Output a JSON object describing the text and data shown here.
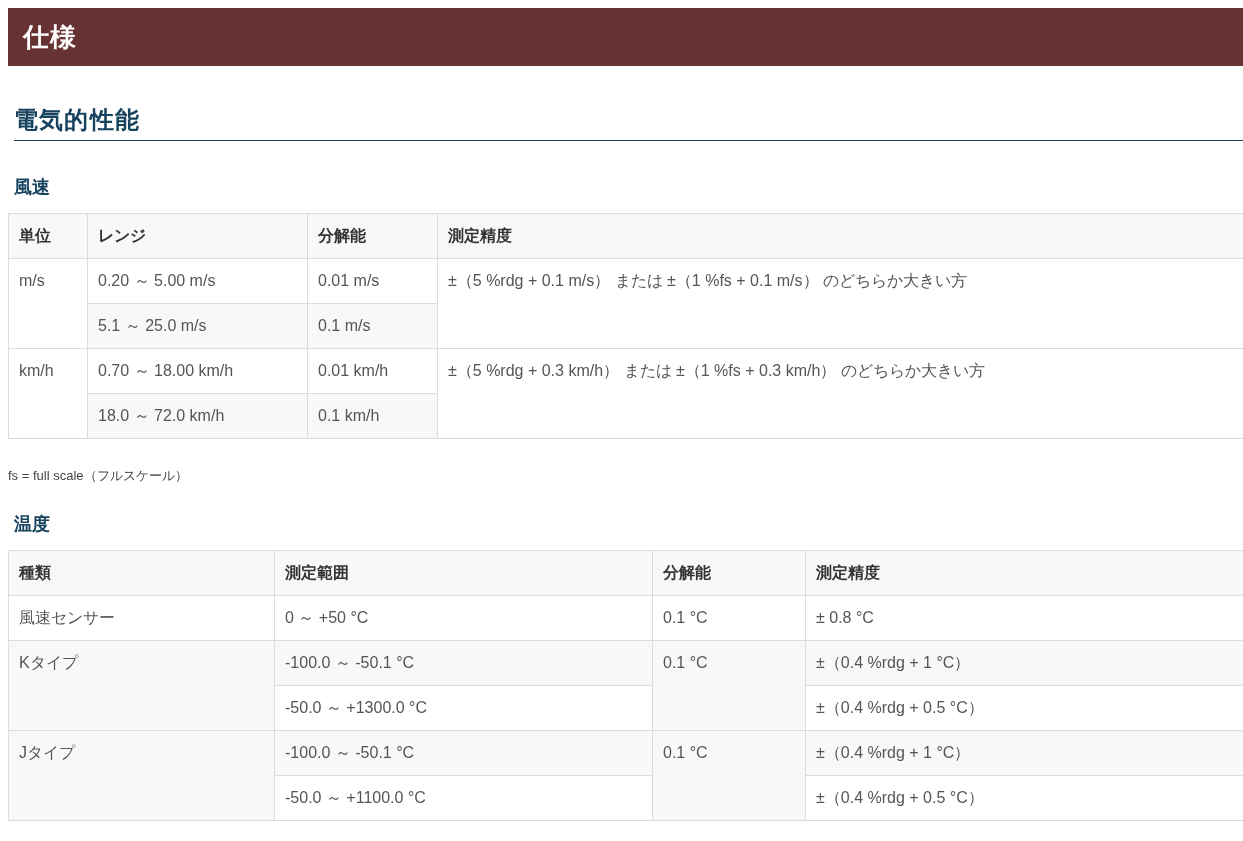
{
  "page_title": "仕様",
  "section_title": "電気的性能",
  "wind": {
    "title": "風速",
    "columns": [
      "単位",
      "レンジ",
      "分解能",
      "測定精度"
    ],
    "groups": [
      {
        "unit": "m/s",
        "accuracy": "±（5 %rdg + 0.1 m/s） または ±（1 %fs + 0.1 m/s） のどちらか大きい方",
        "rows": [
          {
            "range": "0.20 ～ 5.00 m/s",
            "resolution": "0.01 m/s"
          },
          {
            "range": "5.1 ～ 25.0 m/s",
            "resolution": "0.1 m/s"
          }
        ]
      },
      {
        "unit": "km/h",
        "accuracy": "±（5 %rdg + 0.3 km/h） または ±（1 %fs + 0.3 km/h） のどちらか大きい方",
        "rows": [
          {
            "range": "0.70 ～ 18.00 km/h",
            "resolution": "0.01 km/h"
          },
          {
            "range": "18.0 ～ 72.0 km/h",
            "resolution": "0.1 km/h"
          }
        ]
      }
    ],
    "note": "fs = full scale（フルスケール）"
  },
  "temperature": {
    "title": "温度",
    "columns": [
      "種類",
      "測定範囲",
      "分解能",
      "測定精度"
    ],
    "groups": [
      {
        "type": "風速センサー",
        "resolution": "0.1 °C",
        "rows": [
          {
            "range": "0 ～ +50 °C",
            "accuracy": "± 0.8 °C"
          }
        ]
      },
      {
        "type": "Kタイプ",
        "resolution": "0.1 °C",
        "rows": [
          {
            "range": "-100.0 ～ -50.1 °C",
            "accuracy": "±（0.4 %rdg + 1 °C）"
          },
          {
            "range": "-50.0 ～ +1300.0 °C",
            "accuracy": "±（0.4 %rdg + 0.5 °C）"
          }
        ]
      },
      {
        "type": "Jタイプ",
        "resolution": "0.1 °C",
        "rows": [
          {
            "range": "-100.0 ～ -50.1 °C",
            "accuracy": "±（0.4 %rdg + 1 °C）"
          },
          {
            "range": "-50.0 ～ +1100.0 °C",
            "accuracy": "±（0.4 %rdg + 0.5 °C）"
          }
        ]
      }
    ]
  }
}
